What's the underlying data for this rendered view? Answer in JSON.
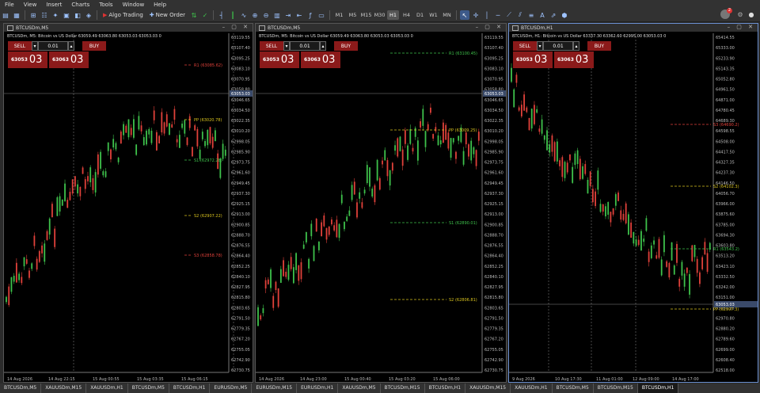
{
  "menu": [
    "File",
    "View",
    "Insert",
    "Charts",
    "Tools",
    "Window",
    "Help"
  ],
  "toolbar": {
    "algo_trading": "Algo Trading",
    "new_order": "New Order",
    "timeframes": [
      "M1",
      "M5",
      "M15",
      "M30",
      "H1",
      "H4",
      "D1",
      "W1",
      "MN"
    ],
    "active_timeframe": "H1",
    "notification_count": "2"
  },
  "colors": {
    "bull": "#3ec14b",
    "bear": "#e0413a",
    "pivot": "#d8c21e",
    "support": "#3ec14b",
    "resistance": "#e0413a",
    "grid": "#555555"
  },
  "charts": [
    {
      "title": "BTCUSDm,M5",
      "info": "BTCUSDm, M5:  Bitcoin vs US Dollar  63059.49 63063.80 63053.03 63053.03  0",
      "otp": {
        "sell": "SELL",
        "buy": "BUY",
        "volume": "0.01",
        "sell_small": "63053",
        "sell_big": "03",
        "buy_small": "63063",
        "buy_big": "03"
      },
      "yticks": [
        "63119.55",
        "63107.40",
        "63095.25",
        "63083.10",
        "63070.95",
        "63058.80",
        "63046.65",
        "63034.50",
        "63022.35",
        "63010.20",
        "62998.05",
        "62985.90",
        "62973.75",
        "62961.60",
        "62949.45",
        "62937.30",
        "62925.15",
        "62913.00",
        "62900.85",
        "62888.70",
        "62876.55",
        "62864.40",
        "62852.25",
        "62840.10",
        "62827.95",
        "62815.80",
        "62803.65",
        "62791.50",
        "62779.35",
        "62767.20",
        "62755.05",
        "62742.90",
        "62730.75"
      ],
      "price_tag": "63053.03",
      "levels": [
        {
          "label": "R1 (63085.62)",
          "kind": "resistance"
        },
        {
          "label": "PP (63020.78)",
          "kind": "pivot"
        },
        {
          "label": "S1 (62972.28)",
          "kind": "support"
        },
        {
          "label": "S2 (62907.22)",
          "kind": "pivot"
        },
        {
          "label": "S3 (62858.78)",
          "kind": "resistance"
        }
      ],
      "xlabels": [
        "14 Aug 2026",
        "14 Aug 22:15",
        "15 Aug 00:55",
        "15 Aug 03:35",
        "15 Aug 06:15"
      ]
    },
    {
      "title": "BTCUSDm,M5",
      "info": "BTCUSDm, M5:  Bitcoin vs US Dollar  63059.49 63063.80 63053.03 63053.03  0",
      "otp": {
        "sell": "SELL",
        "buy": "BUY",
        "volume": "0.01",
        "sell_small": "63053",
        "sell_big": "03",
        "buy_small": "63063",
        "buy_big": "03"
      },
      "yticks": [
        "63119.55",
        "63107.40",
        "63095.25",
        "63083.10",
        "63070.95",
        "63058.80",
        "63046.65",
        "63034.50",
        "63022.35",
        "63010.20",
        "62998.05",
        "62985.90",
        "62973.75",
        "62961.60",
        "62949.45",
        "62937.30",
        "62925.15",
        "62913.00",
        "62900.85",
        "62888.70",
        "62876.55",
        "62864.40",
        "62852.25",
        "62840.10",
        "62827.95",
        "62815.80",
        "62803.65",
        "62791.50",
        "62779.35",
        "62767.20",
        "62755.05",
        "62742.90",
        "62730.75"
      ],
      "price_tag": "63053.03",
      "levels": [
        {
          "label": "R1 (63100.45)",
          "kind": "support"
        },
        {
          "label": "PP (63009.25)",
          "kind": "pivot"
        },
        {
          "label": "S1 (62890.01)",
          "kind": "support"
        },
        {
          "label": "S2 (62806.81)",
          "kind": "pivot"
        }
      ],
      "xlabels": [
        "14 Aug 2026",
        "14 Aug 23:00",
        "15 Aug 00:40",
        "15 Aug 03:20",
        "15 Aug 06:00"
      ]
    },
    {
      "title": "BTCUSDm,H1",
      "info": "BTCUSDm, H1:  Bitcoin vs US Dollar  63337.30 63362.60 62995.00 63053.03  0",
      "otp": {
        "sell": "SELL",
        "buy": "BUY",
        "volume": "0.01",
        "sell_small": "63053",
        "sell_big": "03",
        "buy_small": "63063",
        "buy_big": "03"
      },
      "yticks": [
        "65414.55",
        "65333.00",
        "65233.90",
        "65143.35",
        "65052.80",
        "64961.50",
        "64871.00",
        "64780.45",
        "64689.30",
        "64598.55",
        "64508.00",
        "64417.50",
        "64327.35",
        "64237.30",
        "64146.50",
        "64056.70",
        "63966.00",
        "63875.60",
        "63785.00",
        "63694.30",
        "63603.80",
        "63513.20",
        "63423.10",
        "63332.50",
        "63242.00",
        "63151.00",
        "63061.35",
        "62970.80",
        "62880.20",
        "62789.60",
        "62699.00",
        "62608.40",
        "62518.00"
      ],
      "price_tag": "63053.03",
      "levels": [
        {
          "label": "S3 (64690.2)",
          "kind": "resistance"
        },
        {
          "label": "S2 (64102.3)",
          "kind": "pivot"
        },
        {
          "label": "R1 (63543.2)",
          "kind": "support"
        },
        {
          "label": "PP (62997.3)",
          "kind": "pivot"
        }
      ],
      "xlabels": [
        "9 Aug 2026",
        "10 Aug 17:30",
        "11 Aug 01:00",
        "12 Aug 09:00",
        "14 Aug 17:00"
      ]
    }
  ],
  "tabs": [
    "BTCUSDm,M5",
    "XAUUSDm,M15",
    "XAUUSDm,H1",
    "BTCUSDm,M5",
    "BTCUSDm,H1",
    "EURUSDm,M5",
    "EURUSDm,M15",
    "EURUSDm,H1",
    "XAUUSDm,M5",
    "BTCUSDm,M15",
    "BTCUSDm,H1",
    "XAUUSDm,M15",
    "XAUUSDm,H1",
    "BTCUSDm,M5",
    "BTCUSDm,M15",
    "BTCUSDm,H1"
  ],
  "active_tab": 15
}
